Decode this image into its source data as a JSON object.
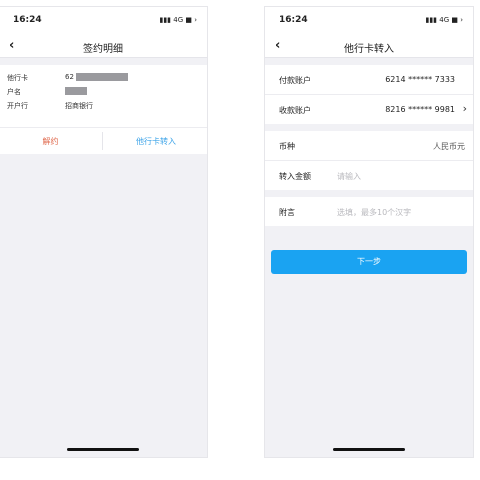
{
  "left": {
    "status": {
      "time": "16:24",
      "signal": "▮▮▮ 4G ■ ›"
    },
    "nav": {
      "back": "‹",
      "title": "签约明细"
    },
    "detail": {
      "rows": [
        {
          "label": "他行卡",
          "value_prefix": "62"
        },
        {
          "label": "户名",
          "value_prefix": ""
        },
        {
          "label": "开户行",
          "value": "招商银行"
        }
      ]
    },
    "actions": {
      "unbind": "解约",
      "transfer": "他行卡转入"
    }
  },
  "right": {
    "status": {
      "time": "16:24",
      "signal": "▮▮▮ 4G ■ ›"
    },
    "nav": {
      "back": "‹",
      "title": "他行卡转入"
    },
    "accounts": {
      "pay_label": "付款账户",
      "pay_value": "6214 ****** 7333",
      "recv_label": "收款账户",
      "recv_value": "8216 ****** 9981",
      "chevron": "›"
    },
    "form": {
      "currency_label": "币种",
      "currency_value": "人民币元",
      "amount_label": "转入金额",
      "amount_placeholder": "请输入",
      "note_label": "附言",
      "note_placeholder": "选填，最多10个汉字"
    },
    "next_button": "下一步"
  }
}
